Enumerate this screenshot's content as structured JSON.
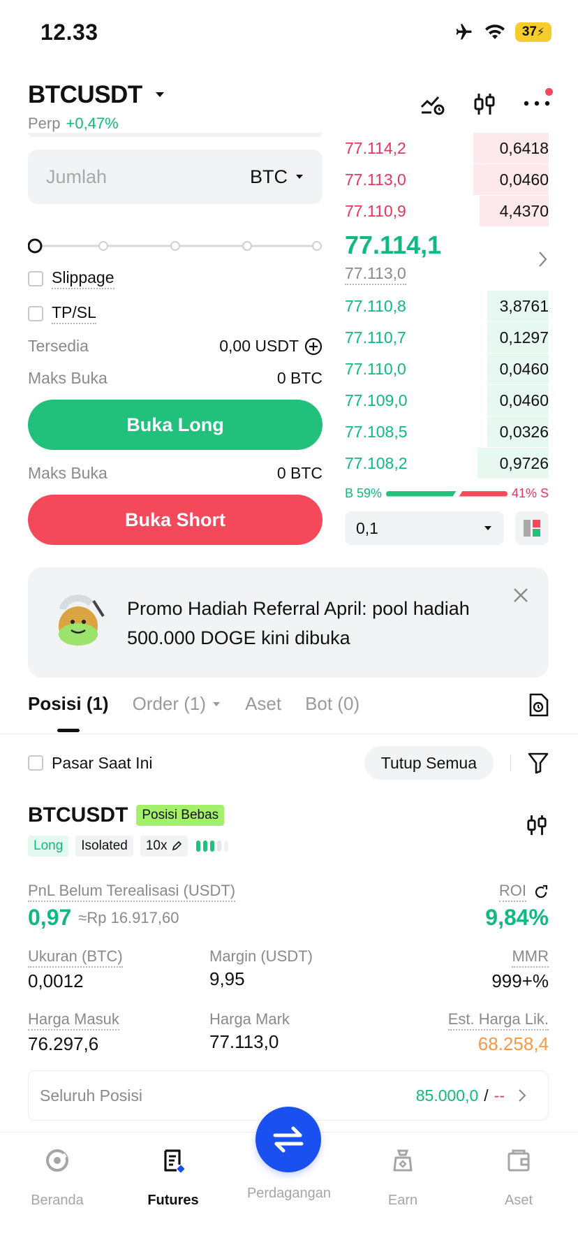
{
  "status_bar": {
    "time": "12.33",
    "battery": "37"
  },
  "header": {
    "pair": "BTCUSDT",
    "type": "Perp",
    "change": "+0,47%"
  },
  "form": {
    "qty_placeholder": "Jumlah",
    "qty_unit": "BTC",
    "slippage_label": "Slippage",
    "tpsl_label": "TP/SL",
    "available_label": "Tersedia",
    "available_value": "0,00 USDT",
    "max_open_label": "Maks Buka",
    "max_open_long": "0 BTC",
    "max_open_short": "0 BTC",
    "long_button": "Buka Long",
    "short_button": "Buka Short"
  },
  "order_book": {
    "asks": [
      {
        "price": "77.114,2",
        "qty": "0,6418",
        "depth": 0.37
      },
      {
        "price": "77.113,0",
        "qty": "0,0460",
        "depth": 0.37
      },
      {
        "price": "77.110,9",
        "qty": "4,4370",
        "depth": 0.34
      }
    ],
    "mid_price": "77.114,1",
    "mark_price": "77.113,0",
    "bids": [
      {
        "price": "77.110,8",
        "qty": "3,8761",
        "depth": 0.3
      },
      {
        "price": "77.110,7",
        "qty": "0,1297",
        "depth": 0.3
      },
      {
        "price": "77.110,0",
        "qty": "0,0460",
        "depth": 0.3
      },
      {
        "price": "77.109,0",
        "qty": "0,0460",
        "depth": 0.3
      },
      {
        "price": "77.108,5",
        "qty": "0,0326",
        "depth": 0.3
      },
      {
        "price": "77.108,2",
        "qty": "0,9726",
        "depth": 0.35
      }
    ],
    "buy_label": "B 59%",
    "sell_label": "41% S",
    "buy_ratio": 0.59,
    "depth_value": "0,1"
  },
  "promo": {
    "text": "Promo Hadiah Referral April: pool hadiah 500.000 DOGE kini dibuka"
  },
  "tabs": [
    {
      "label": "Posisi (1)"
    },
    {
      "label": "Order (1)"
    },
    {
      "label": "Aset"
    },
    {
      "label": "Bot (0)"
    }
  ],
  "filter": {
    "current_market": "Pasar Saat Ini",
    "close_all": "Tutup Semua"
  },
  "position": {
    "pair": "BTCUSDT",
    "badge": "Posisi Bebas",
    "side": "Long",
    "margin_mode": "Isolated",
    "leverage": "10x",
    "pnl_label": "PnL Belum Terealisasi (USDT)",
    "pnl_value": "0,97",
    "pnl_idr": "≈Rp 16.917,60",
    "roi_label": "ROI",
    "roi_value": "9,84%",
    "size_label": "Ukuran (BTC)",
    "size_value": "0,0012",
    "margin_label": "Margin (USDT)",
    "margin_value": "9,95",
    "mmr_label": "MMR",
    "mmr_value": "999+%",
    "entry_label": "Harga Masuk",
    "entry_value": "76.297,6",
    "mark_label": "Harga Mark",
    "mark_value": "77.113,0",
    "liq_label": "Est. Harga Lik.",
    "liq_value": "68.258,4"
  },
  "all_positions": {
    "label": "Seluruh Posisi",
    "value": "85.000,0",
    "sep": "/",
    "suffix": "--"
  },
  "bottom_nav": [
    {
      "label": "Beranda"
    },
    {
      "label": "Futures"
    },
    {
      "label": "Perdagangan"
    },
    {
      "label": "Earn"
    },
    {
      "label": "Aset"
    }
  ],
  "colors": {
    "green": "#10b981",
    "red": "#e7355b",
    "long_button": "#22c07d",
    "short_button": "#f4495b",
    "fab": "#1a4ff0",
    "liq": "#f2994a"
  }
}
